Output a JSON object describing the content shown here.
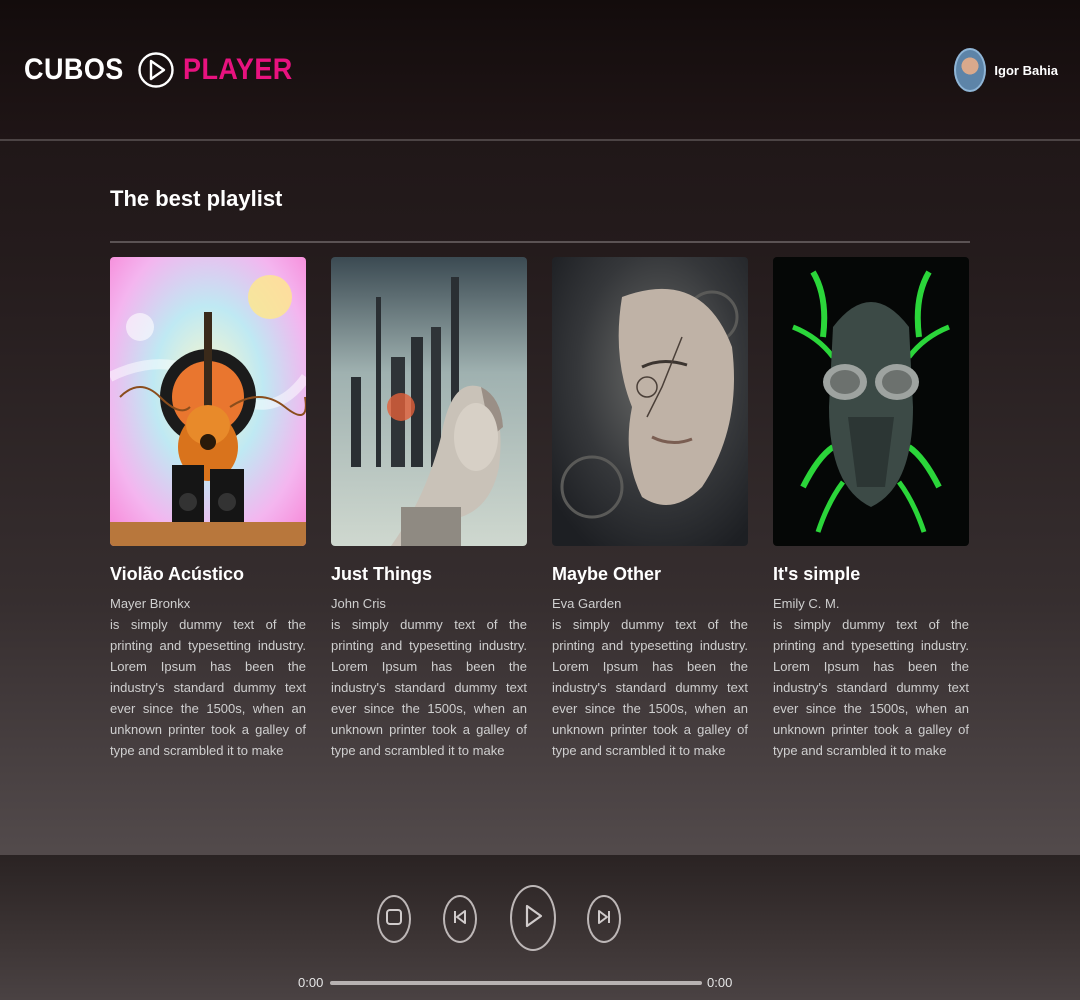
{
  "header": {
    "logo_left": "CUBOS",
    "logo_right": "PLAYER",
    "user_name": "Igor Bahia"
  },
  "main": {
    "title": "The best playlist",
    "playlists": [
      {
        "title": "Violão Acústico",
        "artist": "Mayer Bronkx",
        "description": "is simply dummy text of the printing and typesetting industry. Lorem Ipsum has been the industry's standard dummy text ever since the 1500s, when an unknown printer took a galley of type and scrambled it to make"
      },
      {
        "title": "Just Things",
        "artist": "John Cris",
        "description": "is simply dummy text of the printing and typesetting industry. Lorem Ipsum has been the industry's standard dummy text ever since the 1500s, when an unknown printer took a galley of type and scrambled it to make"
      },
      {
        "title": "Maybe Other",
        "artist": "Eva Garden",
        "description": "is simply dummy text of the printing and typesetting industry. Lorem Ipsum has been the industry's standard dummy text ever since the 1500s, when an unknown printer took a galley of type and scrambled it to make"
      },
      {
        "title": "It's simple",
        "artist": "Emily C. M.",
        "description": "is simply dummy text of the printing and typesetting industry. Lorem Ipsum has been the industry's standard dummy text ever since the 1500s, when an unknown printer took a galley of type and scrambled it to make"
      }
    ]
  },
  "player": {
    "current_time": "0:00",
    "total_time": "0:00",
    "progress": 0,
    "icons": [
      "stop-icon",
      "previous-icon",
      "play-icon",
      "next-icon"
    ]
  },
  "colors": {
    "accent": "#e8127f",
    "text": "#ffffff",
    "muted_text": "#cfcfcf"
  }
}
